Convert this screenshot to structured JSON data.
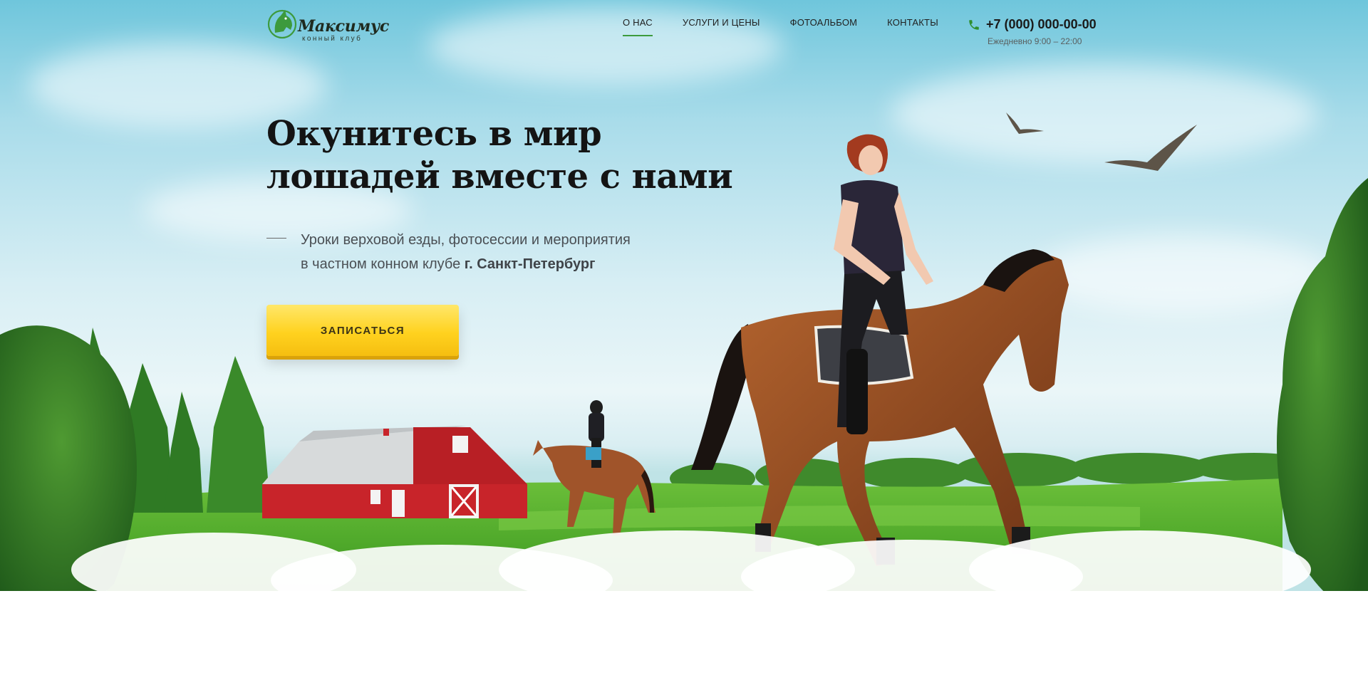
{
  "brand": {
    "name": "Максимус",
    "tagline": "конный клуб",
    "accent_color": "#3d9a3d"
  },
  "nav": {
    "items": [
      {
        "label": "О НАС",
        "active": true
      },
      {
        "label": "УСЛУГИ И ЦЕНЫ",
        "active": false
      },
      {
        "label": "ФОТОАЛЬБОМ",
        "active": false
      },
      {
        "label": "КОНТАКТЫ",
        "active": false
      }
    ]
  },
  "contact": {
    "phone": "+7 (000) 000-00-00",
    "hours": "Ежедневно 9:00 – 22:00",
    "icon": "phone-icon"
  },
  "hero": {
    "headline_line1": "Окунитесь в мир",
    "headline_line2": "лошадей вместе с нами",
    "subtitle_line1": "Уроки верховой езды, фотосессии и мероприятия",
    "subtitle_line2_prefix": "в частном конном клубе ",
    "subtitle_city": "г. Санкт-Петербург",
    "cta_label": "ЗАПИСАТЬСЯ",
    "cta_color": "#ffd21f"
  }
}
